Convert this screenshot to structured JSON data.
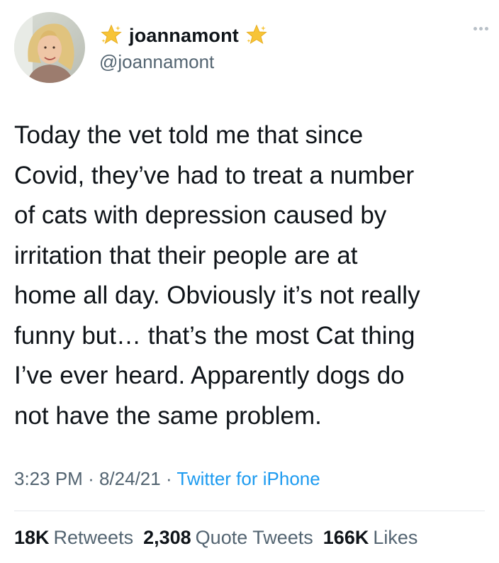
{
  "user": {
    "display_name": "joannamont",
    "handle": "@joannamont"
  },
  "tweet": {
    "text": "Today the vet told me that since\nCovid, they’ve had to treat a number\nof cats with depression caused by\nirritation that their people are at\nhome all day. Obviously it’s not really\nfunny but… that’s the most Cat thing\nI’ve ever heard. Apparently dogs do\nnot have the same problem.",
    "time": "3:23 PM",
    "date": "8/24/21",
    "separator": "·",
    "source": "Twitter for iPhone"
  },
  "stats": {
    "retweets_count": "18K",
    "retweets_label": "Retweets",
    "quotes_count": "2,308",
    "quotes_label": "Quote Tweets",
    "likes_count": "166K",
    "likes_label": "Likes"
  },
  "icons": {
    "name_badge": "sparkle-star-icon",
    "more": "more-options-icon"
  },
  "colors": {
    "text_primary": "#0f1419",
    "text_secondary": "#536471",
    "link": "#1d9bf0",
    "star": "#f7c437"
  }
}
